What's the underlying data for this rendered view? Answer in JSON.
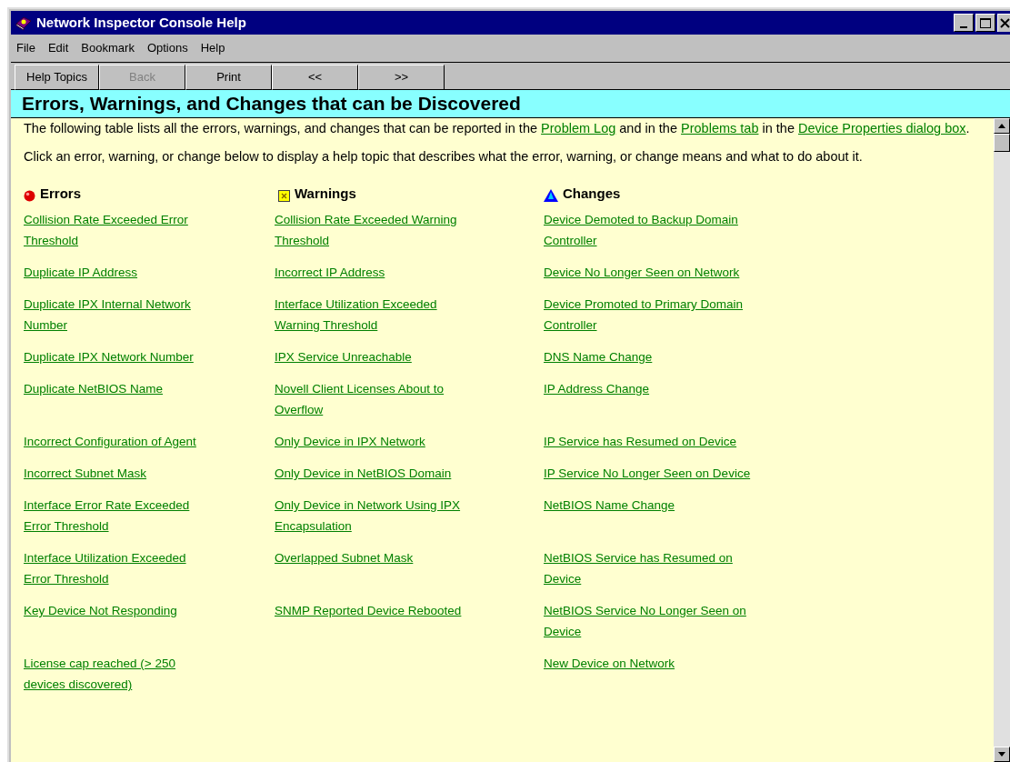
{
  "window": {
    "title": "Network Inspector Console Help"
  },
  "menu": [
    "File",
    "Edit",
    "Bookmark",
    "Options",
    "Help"
  ],
  "toolbar": [
    {
      "label": "Help Topics",
      "disabled": false
    },
    {
      "label": "Back",
      "disabled": true
    },
    {
      "label": "Print",
      "disabled": false
    },
    {
      "label": "<<",
      "disabled": false
    },
    {
      "label": ">>",
      "disabled": false
    }
  ],
  "heading": "Errors, Warnings, and Changes that can be Discovered",
  "intro": [
    {
      "kind": "text",
      "text": "The following table lists all the errors, warnings, and changes that can be reported in the "
    },
    {
      "kind": "link",
      "text": "Problem Log"
    },
    {
      "kind": "text",
      "text": " and in the "
    },
    {
      "kind": "link",
      "text": "Problems tab"
    },
    {
      "kind": "text",
      "text": " in the "
    },
    {
      "kind": "link",
      "text": "Device Properties dialog box"
    },
    {
      "kind": "text",
      "text": "."
    }
  ],
  "instructions": "Click an error, warning, or change below to display a help topic that describes what the error, warning, or change means and what to do about it.",
  "columns": [
    {
      "kind": "error",
      "title": "Errors"
    },
    {
      "kind": "warning",
      "title": "Warnings"
    },
    {
      "kind": "change",
      "title": "Changes"
    }
  ],
  "rows": [
    [
      "Collision Rate Exceeded Error Threshold",
      "Collision Rate Exceeded Warning Threshold",
      "Device Demoted to Backup Domain Controller"
    ],
    [
      "Duplicate IP Address",
      "Incorrect IP Address",
      "Device No Longer Seen on Network"
    ],
    [
      "Duplicate IPX Internal Network Number",
      "Interface Utilization Exceeded Warning Threshold",
      "Device Promoted to Primary Domain Controller"
    ],
    [
      "Duplicate IPX Network Number",
      "IPX Service Unreachable",
      "DNS Name Change"
    ],
    [
      "Duplicate NetBIOS Name",
      "Novell Client Licenses About to Overflow",
      "IP Address Change"
    ],
    [
      "Incorrect Configuration of Agent",
      "Only Device in IPX Network",
      "IP Service has Resumed on Device"
    ],
    [
      "Incorrect Subnet Mask",
      "Only Device in NetBIOS Domain",
      "IP Service No Longer Seen on Device"
    ],
    [
      "Interface Error Rate Exceeded Error Threshold",
      "Only Device in Network Using IPX Encapsulation",
      "NetBIOS Name Change"
    ],
    [
      "Interface Utilization Exceeded Error Threshold",
      "Overlapped Subnet Mask",
      "NetBIOS Service has Resumed on Device"
    ],
    [
      "Key Device Not Responding",
      "SNMP Reported Device Rebooted",
      "NetBIOS Service No Longer Seen on Device"
    ],
    [
      "License cap reached (> 250 devices discovered)",
      null,
      "New Device on Network"
    ]
  ]
}
